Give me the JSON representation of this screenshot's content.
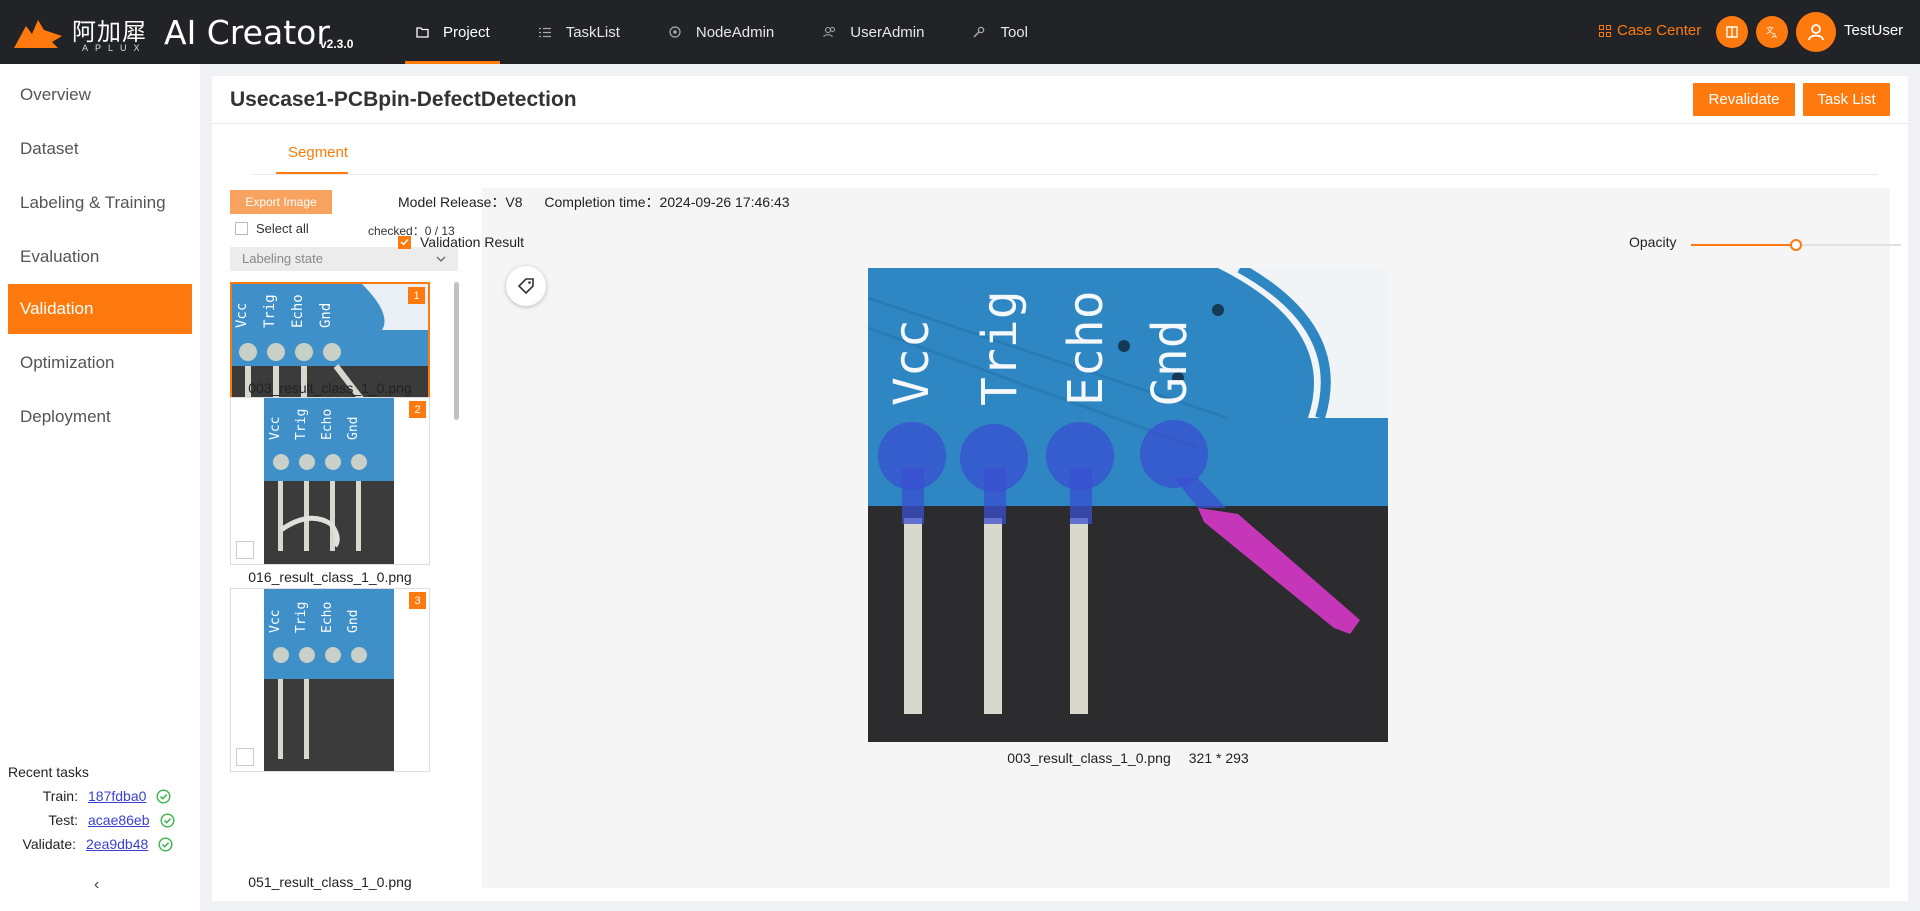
{
  "app": {
    "logo_cn": "阿加犀",
    "logo_en": "APLUX",
    "title": "AI Creator",
    "version": "v2.3.0"
  },
  "nav": [
    {
      "label": "Project",
      "icon": "folder-icon",
      "active": true
    },
    {
      "label": "TaskList",
      "icon": "list-icon",
      "active": false
    },
    {
      "label": "NodeAdmin",
      "icon": "node-icon",
      "active": false
    },
    {
      "label": "UserAdmin",
      "icon": "users-icon",
      "active": false
    },
    {
      "label": "Tool",
      "icon": "wrench-icon",
      "active": false
    }
  ],
  "header_right": {
    "case_center": "Case Center",
    "user": "TestUser"
  },
  "sidebar": {
    "items": [
      {
        "label": "Overview"
      },
      {
        "label": "Dataset"
      },
      {
        "label": "Labeling & Training"
      },
      {
        "label": "Evaluation"
      },
      {
        "label": "Validation"
      },
      {
        "label": "Optimization"
      },
      {
        "label": "Deployment"
      }
    ],
    "active_index": 4,
    "recent_title": "Recent tasks",
    "recent": [
      {
        "label": "Train:",
        "value": "187fdba0"
      },
      {
        "label": "Test:",
        "value": "acae86eb"
      },
      {
        "label": "Validate:",
        "value": "2ea9db48"
      }
    ],
    "collapse": "‹"
  },
  "page": {
    "title": "Usecase1-PCBpin-DefectDetection",
    "revalidate": "Revalidate",
    "task_list": "Task List",
    "tab": "Segment"
  },
  "list": {
    "export_label": "Export Image",
    "select_all": "Select all",
    "checked": "checked：0 / 13",
    "labeling_state": "Labeling state",
    "items": [
      {
        "num": "1",
        "name": "003_result_class_1_0.png"
      },
      {
        "num": "2",
        "name": "016_result_class_1_0.png"
      },
      {
        "num": "3",
        "name": "051_result_class_1_0.png"
      }
    ]
  },
  "viewer": {
    "model_release": "Model Release：V8",
    "completion_time": "Completion time：2024-09-26 17:46:43",
    "validation_result": "Validation Result",
    "opacity_label": "Opacity",
    "opacity": 0.5,
    "image_name": "003_result_class_1_0.png",
    "image_size": "321 * 293",
    "pin_labels": [
      "Vcc",
      "Trig",
      "Echo",
      "Gnd"
    ]
  },
  "colors": {
    "accent": "#ff7a0e",
    "topbar": "#222326",
    "mask_blue": "#3a4fd0",
    "mask_magenta": "#e03ad0"
  }
}
